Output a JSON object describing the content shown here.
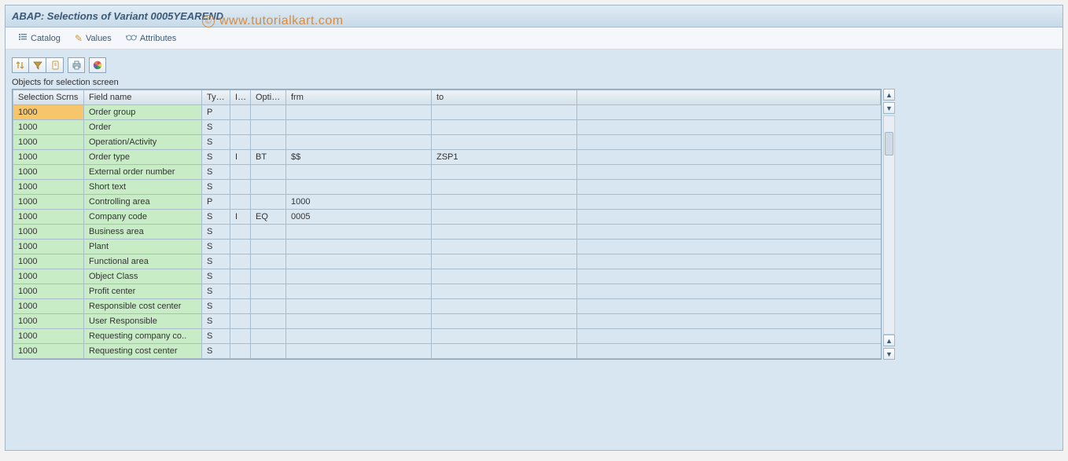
{
  "window": {
    "title": "ABAP: Selections of Variant 0005YEAREND"
  },
  "watermark": "www.tutorialkart.com",
  "watermark_c": "©",
  "app_toolbar": {
    "items": [
      {
        "label": "Catalog",
        "icon": "list-icon"
      },
      {
        "label": "Values",
        "icon": "pencil-icon"
      },
      {
        "label": "Attributes",
        "icon": "glasses-icon"
      }
    ]
  },
  "mini_toolbar": {
    "btn1": "sort-icon",
    "btn2": "filter-icon",
    "btn3": "find-icon",
    "btn4": "print-icon",
    "btn5": "color-icon"
  },
  "section_caption": "Objects for selection screen",
  "table": {
    "headers": {
      "scrn": "Selection Scrns",
      "field": "Field name",
      "type": "Type",
      "ie": "I/E",
      "option": "Option",
      "frm": "frm",
      "to": "to"
    },
    "hdr_rest": "",
    "rows": [
      {
        "scrn": "1000",
        "field": "Order group",
        "type": "P",
        "ie": "",
        "option": "",
        "frm": "",
        "to": "",
        "highlight": true
      },
      {
        "scrn": "1000",
        "field": "Order",
        "type": "S",
        "ie": "",
        "option": "",
        "frm": "",
        "to": ""
      },
      {
        "scrn": "1000",
        "field": "Operation/Activity",
        "type": "S",
        "ie": "",
        "option": "",
        "frm": "",
        "to": ""
      },
      {
        "scrn": "1000",
        "field": "Order type",
        "type": "S",
        "ie": "I",
        "option": "BT",
        "frm": "$$",
        "to": "ZSP1"
      },
      {
        "scrn": "1000",
        "field": "External order number",
        "type": "S",
        "ie": "",
        "option": "",
        "frm": "",
        "to": ""
      },
      {
        "scrn": "1000",
        "field": "Short text",
        "type": "S",
        "ie": "",
        "option": "",
        "frm": "",
        "to": ""
      },
      {
        "scrn": "1000",
        "field": "Controlling area",
        "type": "P",
        "ie": "",
        "option": "",
        "frm": "1000",
        "to": ""
      },
      {
        "scrn": "1000",
        "field": "Company code",
        "type": "S",
        "ie": "I",
        "option": "EQ",
        "frm": "0005",
        "to": ""
      },
      {
        "scrn": "1000",
        "field": "Business area",
        "type": "S",
        "ie": "",
        "option": "",
        "frm": "",
        "to": ""
      },
      {
        "scrn": "1000",
        "field": "Plant",
        "type": "S",
        "ie": "",
        "option": "",
        "frm": "",
        "to": ""
      },
      {
        "scrn": "1000",
        "field": "Functional area",
        "type": "S",
        "ie": "",
        "option": "",
        "frm": "",
        "to": ""
      },
      {
        "scrn": "1000",
        "field": "Object Class",
        "type": "S",
        "ie": "",
        "option": "",
        "frm": "",
        "to": ""
      },
      {
        "scrn": "1000",
        "field": "Profit center",
        "type": "S",
        "ie": "",
        "option": "",
        "frm": "",
        "to": ""
      },
      {
        "scrn": "1000",
        "field": "Responsible cost center",
        "type": "S",
        "ie": "",
        "option": "",
        "frm": "",
        "to": ""
      },
      {
        "scrn": "1000",
        "field": "User Responsible",
        "type": "S",
        "ie": "",
        "option": "",
        "frm": "",
        "to": ""
      },
      {
        "scrn": "1000",
        "field": "Requesting company co..",
        "type": "S",
        "ie": "",
        "option": "",
        "frm": "",
        "to": ""
      },
      {
        "scrn": "1000",
        "field": "Requesting cost center",
        "type": "S",
        "ie": "",
        "option": "",
        "frm": "",
        "to": ""
      }
    ]
  }
}
